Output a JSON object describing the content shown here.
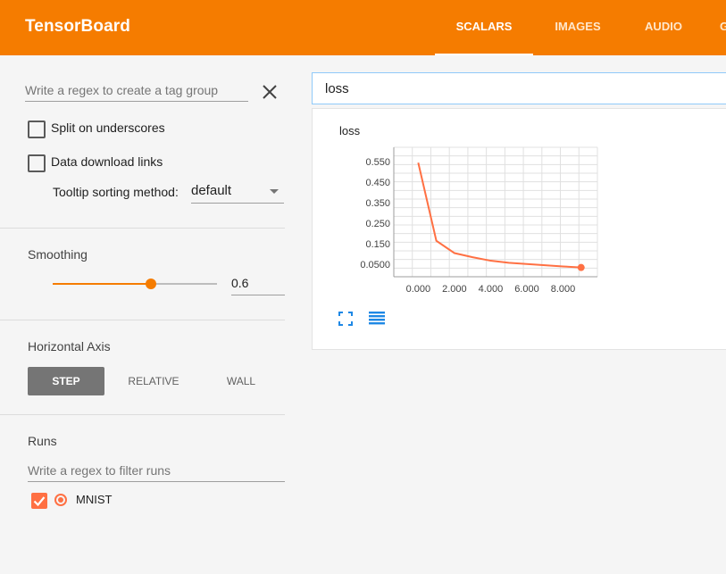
{
  "app": {
    "title": "TensorBoard"
  },
  "tabs": [
    {
      "label": "SCALARS",
      "active": true
    },
    {
      "label": "IMAGES",
      "active": false
    },
    {
      "label": "AUDIO",
      "active": false
    },
    {
      "label": "G",
      "active": false
    }
  ],
  "sidebar": {
    "tag_group_placeholder": "Write a regex to create a tag group",
    "split_underscores": {
      "label": "Split on underscores",
      "checked": false
    },
    "data_download": {
      "label": "Data download links",
      "checked": false
    },
    "tooltip_sorting": {
      "label": "Tooltip sorting method:",
      "value": "default"
    },
    "smoothing": {
      "title": "Smoothing",
      "value": "0.6",
      "fraction": 0.6
    },
    "horizontal_axis": {
      "title": "Horizontal Axis",
      "options": [
        "STEP",
        "RELATIVE",
        "WALL"
      ],
      "selected": "STEP"
    },
    "runs": {
      "title": "Runs",
      "filter_placeholder": "Write a regex to filter runs",
      "items": [
        {
          "name": "MNIST",
          "checked": true,
          "color": "#ff7043"
        }
      ]
    }
  },
  "main": {
    "tag_filter_value": "loss",
    "card": {
      "title": "loss"
    }
  },
  "colors": {
    "accent": "#f57c00",
    "series": "#ff7043",
    "icon_blue": "#1e88e5"
  },
  "icons": {
    "clear": "close-icon",
    "expand": "fullscreen-icon",
    "data": "list-icon"
  },
  "chart_data": {
    "type": "line",
    "title": "loss",
    "x_ticks": [
      "0.000",
      "2.000",
      "4.000",
      "6.000",
      "8.000"
    ],
    "y_ticks": [
      "0.0500",
      "0.150",
      "0.250",
      "0.350",
      "0.450",
      "0.550"
    ],
    "xlim": [
      -1.35,
      9.9
    ],
    "ylim": [
      -0.01,
      0.62
    ],
    "grid": true,
    "series": [
      {
        "name": "MNIST",
        "x": [
          0,
          1,
          2,
          3,
          4,
          5,
          6,
          7,
          8,
          9
        ],
        "y": [
          0.545,
          0.165,
          0.105,
          0.085,
          0.068,
          0.058,
          0.052,
          0.046,
          0.04,
          0.035
        ]
      }
    ]
  }
}
